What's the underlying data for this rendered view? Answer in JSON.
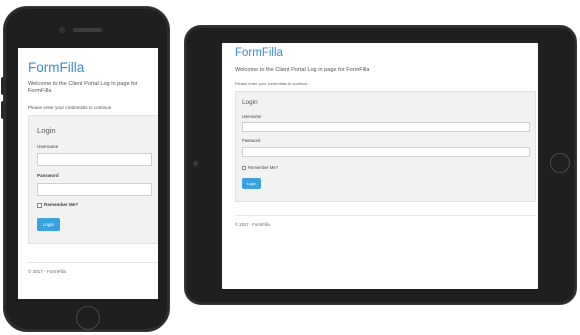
{
  "app": {
    "brand": "FormFilla",
    "intro": "Welcome to the Client Portal Log in page for FormFilla",
    "hint": "Please enter your credentials to continue",
    "footer": "© 2017 - FormFilla"
  },
  "login": {
    "title": "Login",
    "username_label": "Username",
    "username_value": "",
    "password_label": "Password",
    "password_value": "",
    "remember_label": "Remember Me?",
    "remember_checked": false,
    "submit_label": "Login"
  },
  "colors": {
    "brand": "#3a8fd0",
    "button": "#3aa1de",
    "panel": "#f2f2f2",
    "device_frame": "#1f1f1f"
  },
  "devices": [
    "phone",
    "tablet"
  ]
}
